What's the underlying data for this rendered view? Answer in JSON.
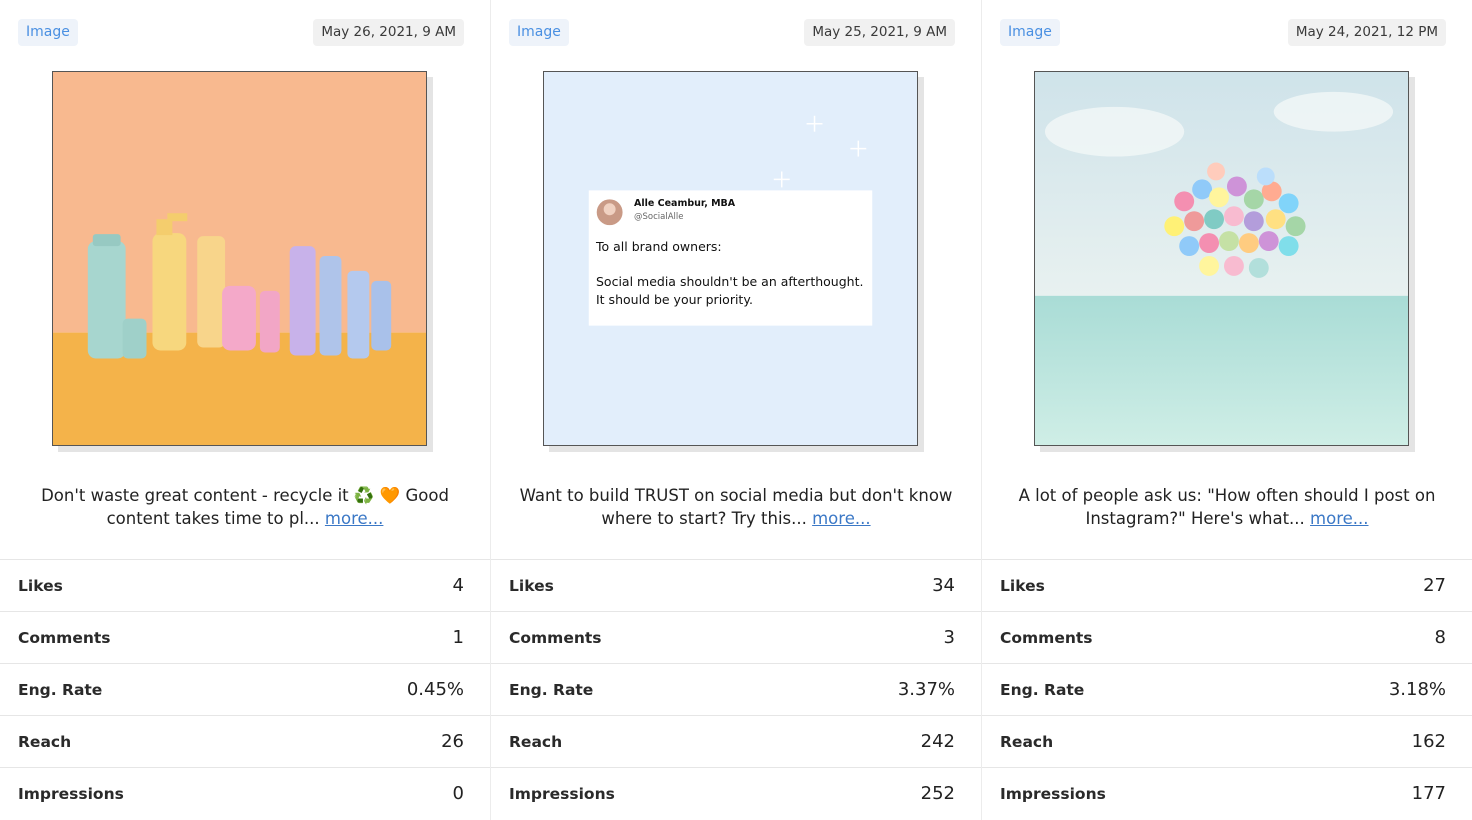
{
  "posts": [
    {
      "badge": "Image",
      "date": "May 26, 2021, 9 AM",
      "image_desc": "pastel cosmetic bottles",
      "caption": "Don't waste great content - recycle it ♻️ 🧡 Good content takes time to pl...",
      "more": "more...",
      "stats": [
        {
          "label": "Likes",
          "value": "4"
        },
        {
          "label": "Comments",
          "value": "1"
        },
        {
          "label": "Eng. Rate",
          "value": "0.45%"
        },
        {
          "label": "Reach",
          "value": "26"
        },
        {
          "label": "Impressions",
          "value": "0"
        }
      ]
    },
    {
      "badge": "Image",
      "date": "May 25, 2021, 9 AM",
      "image_desc": "tweet screenshot",
      "tweet": {
        "name": "Alle Ceambur, MBA",
        "handle": "@SocialAlle",
        "line1": "To all brand owners:",
        "line2": "Social media shouldn't be an afterthought.",
        "line3": "It should be your priority."
      },
      "caption": "Want to build TRUST on social media but don't know where to start? Try this...",
      "more": "more...",
      "stats": [
        {
          "label": "Likes",
          "value": "34"
        },
        {
          "label": "Comments",
          "value": "3"
        },
        {
          "label": "Eng. Rate",
          "value": "3.37%"
        },
        {
          "label": "Reach",
          "value": "242"
        },
        {
          "label": "Impressions",
          "value": "252"
        }
      ]
    },
    {
      "badge": "Image",
      "date": "May 24, 2021, 12 PM",
      "image_desc": "balloons over sea",
      "caption": "A lot of people ask us: \"How often should I post on Instagram?\" Here's what...",
      "more": "more...",
      "stats": [
        {
          "label": "Likes",
          "value": "27"
        },
        {
          "label": "Comments",
          "value": "8"
        },
        {
          "label": "Eng. Rate",
          "value": "3.18%"
        },
        {
          "label": "Reach",
          "value": "162"
        },
        {
          "label": "Impressions",
          "value": "177"
        }
      ]
    }
  ]
}
